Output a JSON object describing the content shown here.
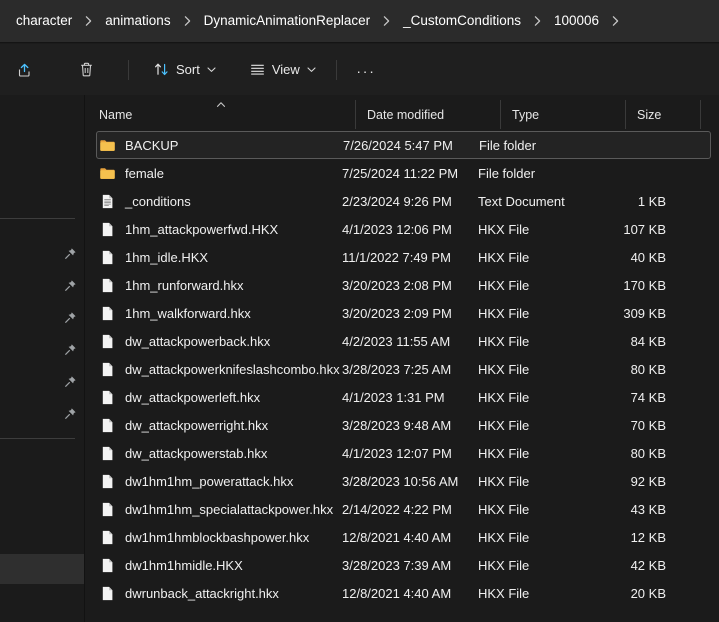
{
  "window": {
    "app": "File Explorer",
    "theme_accent": "#4cc2ff",
    "folder_icon_color": "#f5c14e",
    "background": "#1b1b1b"
  },
  "addressbar": {
    "name": "breadcrumb",
    "crumbs": [
      {
        "label": "character"
      },
      {
        "label": "animations"
      },
      {
        "label": "DynamicAnimationReplacer"
      },
      {
        "label": "_CustomConditions"
      },
      {
        "label": "100006"
      }
    ],
    "trailing_separator": true
  },
  "toolbar": {
    "share_label": "",
    "share_icon": "share-icon",
    "delete_label": "",
    "delete_icon": "trash-icon",
    "sort_label": "Sort",
    "sort_icon": "sort-arrows-icon",
    "view_label": "View",
    "view_icon": "view-list-icon",
    "more_label": "...",
    "more_icon": "ellipsis-icon"
  },
  "navpane": {
    "name": "navigation-pane",
    "pinned_items": [
      {
        "icon": "pin-icon",
        "label": ""
      },
      {
        "icon": "pin-icon",
        "label": ""
      },
      {
        "icon": "pin-icon",
        "label": ""
      },
      {
        "icon": "pin-icon",
        "label": ""
      },
      {
        "icon": "pin-icon",
        "label": ""
      },
      {
        "icon": "pin-icon",
        "label": ""
      }
    ],
    "selected_row_index": 6
  },
  "columns": {
    "name": {
      "label": "Name",
      "sort_direction": "ascending"
    },
    "date_modified": {
      "label": "Date modified"
    },
    "type": {
      "label": "Type"
    },
    "size": {
      "label": "Size"
    }
  },
  "files": [
    {
      "name": "BACKUP",
      "date": "7/26/2024 5:47 PM",
      "type": "File folder",
      "size": "",
      "icon": "folder-icon",
      "focused": true
    },
    {
      "name": "female",
      "date": "7/25/2024 11:22 PM",
      "type": "File folder",
      "size": "",
      "icon": "folder-icon",
      "focused": false
    },
    {
      "name": "_conditions",
      "date": "2/23/2024 9:26 PM",
      "type": "Text Document",
      "size": "1 KB",
      "icon": "text-document-icon",
      "focused": false
    },
    {
      "name": "1hm_attackpowerfwd.HKX",
      "date": "4/1/2023 12:06 PM",
      "type": "HKX File",
      "size": "107 KB",
      "icon": "generic-file-icon",
      "focused": false
    },
    {
      "name": "1hm_idle.HKX",
      "date": "11/1/2022 7:49 PM",
      "type": "HKX File",
      "size": "40 KB",
      "icon": "generic-file-icon",
      "focused": false
    },
    {
      "name": "1hm_runforward.hkx",
      "date": "3/20/2023 2:08 PM",
      "type": "HKX File",
      "size": "170 KB",
      "icon": "generic-file-icon",
      "focused": false
    },
    {
      "name": "1hm_walkforward.hkx",
      "date": "3/20/2023 2:09 PM",
      "type": "HKX File",
      "size": "309 KB",
      "icon": "generic-file-icon",
      "focused": false
    },
    {
      "name": "dw_attackpowerback.hkx",
      "date": "4/2/2023 11:55 AM",
      "type": "HKX File",
      "size": "84 KB",
      "icon": "generic-file-icon",
      "focused": false
    },
    {
      "name": "dw_attackpowerknifeslashcombo.hkx",
      "date": "3/28/2023 7:25 AM",
      "type": "HKX File",
      "size": "80 KB",
      "icon": "generic-file-icon",
      "focused": false
    },
    {
      "name": "dw_attackpowerleft.hkx",
      "date": "4/1/2023 1:31 PM",
      "type": "HKX File",
      "size": "74 KB",
      "icon": "generic-file-icon",
      "focused": false
    },
    {
      "name": "dw_attackpowerright.hkx",
      "date": "3/28/2023 9:48 AM",
      "type": "HKX File",
      "size": "70 KB",
      "icon": "generic-file-icon",
      "focused": false
    },
    {
      "name": "dw_attackpowerstab.hkx",
      "date": "4/1/2023 12:07 PM",
      "type": "HKX File",
      "size": "80 KB",
      "icon": "generic-file-icon",
      "focused": false
    },
    {
      "name": "dw1hm1hm_powerattack.hkx",
      "date": "3/28/2023 10:56 AM",
      "type": "HKX File",
      "size": "92 KB",
      "icon": "generic-file-icon",
      "focused": false
    },
    {
      "name": "dw1hm1hm_specialattackpower.hkx",
      "date": "2/14/2022 4:22 PM",
      "type": "HKX File",
      "size": "43 KB",
      "icon": "generic-file-icon",
      "focused": false
    },
    {
      "name": "dw1hm1hmblockbashpower.hkx",
      "date": "12/8/2021 4:40 AM",
      "type": "HKX File",
      "size": "12 KB",
      "icon": "generic-file-icon",
      "focused": false
    },
    {
      "name": "dw1hm1hmidle.HKX",
      "date": "3/28/2023 7:39 AM",
      "type": "HKX File",
      "size": "42 KB",
      "icon": "generic-file-icon",
      "focused": false
    },
    {
      "name": "dwrunback_attackright.hkx",
      "date": "12/8/2021 4:40 AM",
      "type": "HKX File",
      "size": "20 KB",
      "icon": "generic-file-icon",
      "focused": false
    }
  ]
}
